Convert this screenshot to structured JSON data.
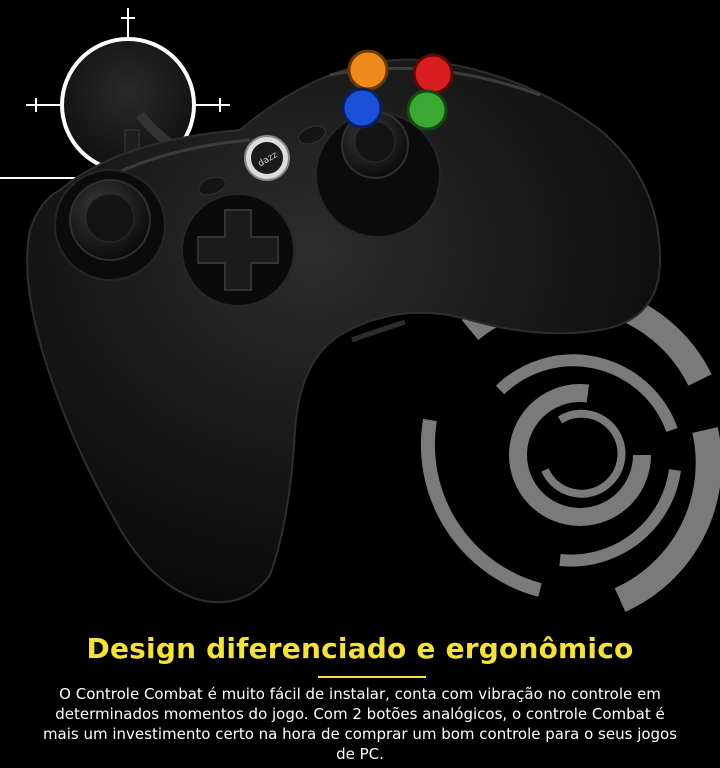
{
  "product": {
    "brand": "dazz"
  },
  "feature": {
    "title": "Design diferenciado e ergonômico",
    "description": "O Controle Combat é muito fácil de instalar, conta com vibração no controle em determinados momentos do jogo. Com 2 botões analógicos, o controle Combat é mais um investimento certo na hora de comprar um bom controle para o seus jogos de PC."
  },
  "colors": {
    "background": "#000000",
    "title": "#f4e23a",
    "text": "#ffffff",
    "rings": "#7a7a7a",
    "button_orange": "#f08a1c",
    "button_red": "#d81e1e",
    "button_blue": "#1c50d8",
    "button_green": "#3aa832"
  },
  "icons": {
    "gamepad": "gamepad-icon",
    "decorative_rings": "concentric-rings-icon",
    "magnifier": "zoom-detail-icon"
  }
}
